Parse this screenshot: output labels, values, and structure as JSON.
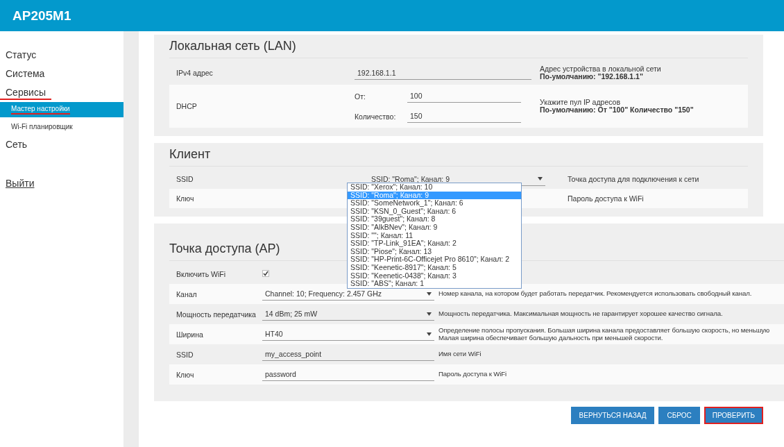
{
  "header": {
    "title": "AP205M1"
  },
  "sidebar": {
    "items": [
      {
        "label": "Статус",
        "selected": false,
        "underlined": false
      },
      {
        "label": "Система",
        "selected": false,
        "underlined": false
      },
      {
        "label": "Сервисы",
        "selected": false,
        "underlined": true,
        "children": [
          {
            "label": "Мастер настройки",
            "selected": true,
            "underlined": true
          },
          {
            "label": "Wi-Fi планировщик",
            "selected": false,
            "underlined": false
          }
        ]
      },
      {
        "label": "Сеть",
        "selected": false,
        "underlined": false
      }
    ],
    "logout": "Выйти"
  },
  "lan": {
    "title": "Локальная сеть (LAN)",
    "rows": [
      {
        "kind": "text",
        "label": "IPv4 адрес",
        "value": "192.168.1.1",
        "hint": "Адрес устройства в локальной сети",
        "default": "По-умолчанию: \"192.168.1.1\""
      },
      {
        "kind": "range",
        "label": "DHCP",
        "fields": [
          {
            "label": "От:",
            "value": "100"
          },
          {
            "label": "Количество:",
            "value": "150"
          }
        ],
        "hint": "Укажите пул IP адресов",
        "default": "По-умолчанию: От \"100\" Количество \"150\""
      }
    ]
  },
  "client": {
    "title": "Клиент",
    "rows": [
      {
        "kind": "select",
        "label": "SSID",
        "value": "SSID: \"Roma\"; Канал: 9",
        "hint": "Точка доступа для подключения к сети"
      },
      {
        "kind": "covered",
        "label": "Ключ",
        "hint": "Пароль доступа к WiFi"
      }
    ],
    "dropdown": {
      "options": [
        {
          "label": "SSID: \"Xerox\"; Канал: 10",
          "selected": false
        },
        {
          "label": "SSID: \"Roma\"; Канал: 9",
          "selected": true
        },
        {
          "label": "SSID: \"SomeNetwork_1\"; Канал: 6",
          "selected": false
        },
        {
          "label": "SSID: \"KSN_0_Guest\"; Канал: 6",
          "selected": false
        },
        {
          "label": "SSID: \"39guest\"; Канал: 8",
          "selected": false
        },
        {
          "label": "SSID: \"AlkBNev\"; Канал: 9",
          "selected": false
        },
        {
          "label": "SSID: \"\"; Канал: 11",
          "selected": false
        },
        {
          "label": "SSID: \"TP-Link_91EA\"; Канал: 2",
          "selected": false
        },
        {
          "label": "SSID: \"Piose\"; Канал: 13",
          "selected": false
        },
        {
          "label": "SSID: \"HP-Print-6C-Officejet Pro 8610\"; Канал: 2",
          "selected": false
        },
        {
          "label": "SSID: \"Keenetic-8917\"; Канал: 5",
          "selected": false
        },
        {
          "label": "SSID: \"Keenetic-0438\"; Канал: 3",
          "selected": false
        },
        {
          "label": "SSID: \"ABS\"; Канал: 1",
          "selected": false
        }
      ]
    }
  },
  "ap": {
    "title": "Точка доступа (AP)",
    "rows": [
      {
        "kind": "checkbox",
        "label": "Включить WiFi",
        "checked": true,
        "hints": []
      },
      {
        "kind": "select",
        "label": "Канал",
        "value": "Channel: 10; Frequency: 2.457 GHz",
        "hints": [
          "Номер канала, на котором будет работать передатчик. Рекомендуется использовать свободный канал."
        ]
      },
      {
        "kind": "select",
        "label": "Мощность передатчика",
        "value": "14 dBm; 25 mW",
        "hints": [
          "Мощность передатчика. Максимальная мощность не гарантирует хорошее качество сигнала."
        ]
      },
      {
        "kind": "select",
        "label": "Ширина",
        "value": "HT40",
        "hints": [
          "Определение полосы пропускания. Большая ширина канала предоставляет большую скорость, но меньшую",
          "Малая ширина обеспечивает большую дальность при меньшей скорости."
        ]
      },
      {
        "kind": "text",
        "label": "SSID",
        "value": "my_access_point",
        "hints": [
          "Имя сети WiFi"
        ]
      },
      {
        "kind": "text",
        "label": "Ключ",
        "value": "password",
        "hints": [
          "Пароль доступа к WiFi"
        ]
      }
    ]
  },
  "buttons": [
    {
      "label": "ВЕРНУТЬСЯ НАЗАД",
      "highlighted": false
    },
    {
      "label": "СБРОС",
      "highlighted": false
    },
    {
      "label": "ПРОВЕРИТЬ",
      "highlighted": true
    }
  ]
}
